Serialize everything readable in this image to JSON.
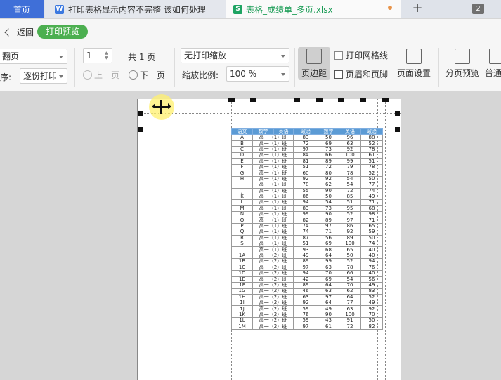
{
  "tabs": {
    "home": "首页",
    "doc": "打印表格显示内容不完整 该如何处理",
    "doc_icon": "W",
    "xls": "表格_成绩单_多页.xlsx",
    "xls_icon": "S",
    "plus": "+",
    "count": "2"
  },
  "back": {
    "label": "返回",
    "mode": "打印预览"
  },
  "toolbar": {
    "flip_dropdown": "翻页",
    "order_label": "序:",
    "order_dropdown": "逐份打印",
    "copies": "1",
    "total_pages": "共 1 页",
    "prev": "上一页",
    "next": "下一页",
    "scale_mode": "无打印缩放",
    "scale_label": "缩放比例:",
    "scale_value": "100 %",
    "margins": "页边距",
    "grid": "打印网格线",
    "header_footer": "页眉和页脚",
    "page_setup": "页面设置",
    "page_break": "分页预览",
    "normal": "普通"
  },
  "sheet": {
    "headers": [
      "语文",
      "数学",
      "英语",
      "政治",
      "数学",
      "英语",
      "政治"
    ],
    "rows": [
      [
        "A",
        "高一（1）班",
        "83",
        "50",
        "96",
        "88"
      ],
      [
        "B",
        "高一（1）班",
        "72",
        "69",
        "63",
        "52"
      ],
      [
        "C",
        "高一（1）班",
        "97",
        "73",
        "92",
        "78"
      ],
      [
        "D",
        "高一（1）班",
        "84",
        "66",
        "100",
        "61"
      ],
      [
        "E",
        "高一（1）班",
        "81",
        "89",
        "99",
        "51"
      ],
      [
        "F",
        "高一（1）班",
        "51",
        "72",
        "79",
        "78"
      ],
      [
        "G",
        "高一（1）班",
        "60",
        "80",
        "78",
        "52"
      ],
      [
        "H",
        "高一（1）班",
        "92",
        "92",
        "54",
        "50"
      ],
      [
        "I",
        "高一（1）班",
        "78",
        "62",
        "54",
        "77"
      ],
      [
        "J",
        "高一（1）班",
        "55",
        "90",
        "72",
        "74"
      ],
      [
        "K",
        "高一（1）班",
        "86",
        "50",
        "85",
        "49"
      ],
      [
        "L",
        "高一（1）班",
        "94",
        "54",
        "51",
        "71"
      ],
      [
        "M",
        "高一（1）班",
        "83",
        "73",
        "95",
        "68"
      ],
      [
        "N",
        "高一（1）班",
        "99",
        "90",
        "52",
        "98"
      ],
      [
        "O",
        "高一（1）班",
        "82",
        "89",
        "97",
        "71"
      ],
      [
        "P",
        "高一（1）班",
        "74",
        "97",
        "86",
        "65"
      ],
      [
        "Q",
        "高一（1）班",
        "74",
        "71",
        "92",
        "59"
      ],
      [
        "R",
        "高一（1）班",
        "87",
        "56",
        "89",
        "50"
      ],
      [
        "S",
        "高一（1）班",
        "51",
        "69",
        "100",
        "74"
      ],
      [
        "T",
        "高一（1）班",
        "93",
        "68",
        "65",
        "40"
      ],
      [
        "1A",
        "高一（2）班",
        "49",
        "64",
        "50",
        "40"
      ],
      [
        "1B",
        "高一（2）班",
        "89",
        "99",
        "52",
        "94"
      ],
      [
        "1C",
        "高一（2）班",
        "97",
        "63",
        "78",
        "76"
      ],
      [
        "1D",
        "高一（2）班",
        "94",
        "70",
        "66",
        "40"
      ],
      [
        "1E",
        "高一（2）班",
        "42",
        "69",
        "54",
        "56"
      ],
      [
        "1F",
        "高一（2）班",
        "89",
        "64",
        "70",
        "49"
      ],
      [
        "1G",
        "高一（2）班",
        "46",
        "63",
        "62",
        "83"
      ],
      [
        "1H",
        "高一（2）班",
        "63",
        "97",
        "64",
        "52"
      ],
      [
        "1I",
        "高一（2）班",
        "92",
        "64",
        "77",
        "49"
      ],
      [
        "1J",
        "高一（2）班",
        "59",
        "49",
        "63",
        "92"
      ],
      [
        "1K",
        "高一（2）班",
        "76",
        "90",
        "100",
        "70"
      ],
      [
        "1L",
        "高一（2）班",
        "59",
        "43",
        "91",
        "50"
      ],
      [
        "1M",
        "高一（2）班",
        "97",
        "61",
        "72",
        "82"
      ]
    ]
  },
  "colors": {
    "home_tab": "#3f6fd8",
    "preview_pill": "#4caf50",
    "sheet_header": "#5b9bd5",
    "xls_green": "#1e9e58"
  }
}
